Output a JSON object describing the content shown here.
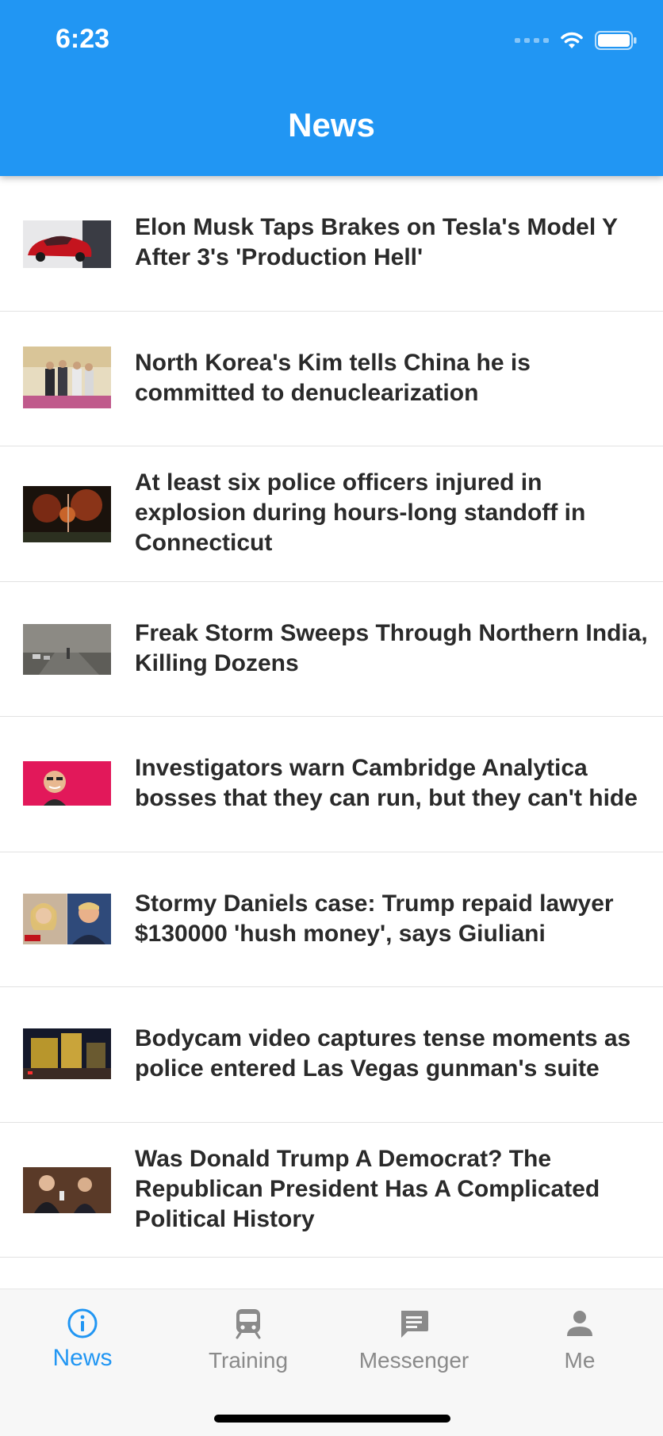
{
  "status_bar": {
    "time": "6:23"
  },
  "header": {
    "title": "News"
  },
  "news": [
    {
      "headline": [
        "Elon Musk Taps Brakes on Tesla's Model Y",
        "After 3's 'Production Hell'"
      ]
    },
    {
      "headline": [
        "North Korea's Kim tells China he is",
        "committed to denuclearization"
      ]
    },
    {
      "headline": [
        "At least six police officers injured in",
        "explosion during hours-long standoff in",
        "Connecticut"
      ]
    },
    {
      "headline": [
        "Freak Storm Sweeps Through Northern India,",
        "Killing Dozens"
      ]
    },
    {
      "headline": [
        "Investigators warn Cambridge Analytica",
        "bosses that they can run, but they can't hide"
      ]
    },
    {
      "headline": [
        "Stormy Daniels case: Trump repaid lawyer",
        "$130000 'hush money', says Giuliani"
      ]
    },
    {
      "headline": [
        "Bodycam video captures tense moments as",
        "police entered Las Vegas gunman's suite"
      ]
    },
    {
      "headline": [
        "Was Donald Trump A Democrat? The",
        "Republican President Has A Complicated",
        "Political History"
      ]
    }
  ],
  "tabbar": {
    "tabs": [
      {
        "label": "News",
        "icon": "info-circle-icon",
        "active": true
      },
      {
        "label": "Training",
        "icon": "train-icon",
        "active": false
      },
      {
        "label": "Messenger",
        "icon": "message-icon",
        "active": false
      },
      {
        "label": "Me",
        "icon": "person-icon",
        "active": false
      }
    ]
  },
  "colors": {
    "accent": "#2196F3",
    "inactive": "#8a8a8a"
  }
}
